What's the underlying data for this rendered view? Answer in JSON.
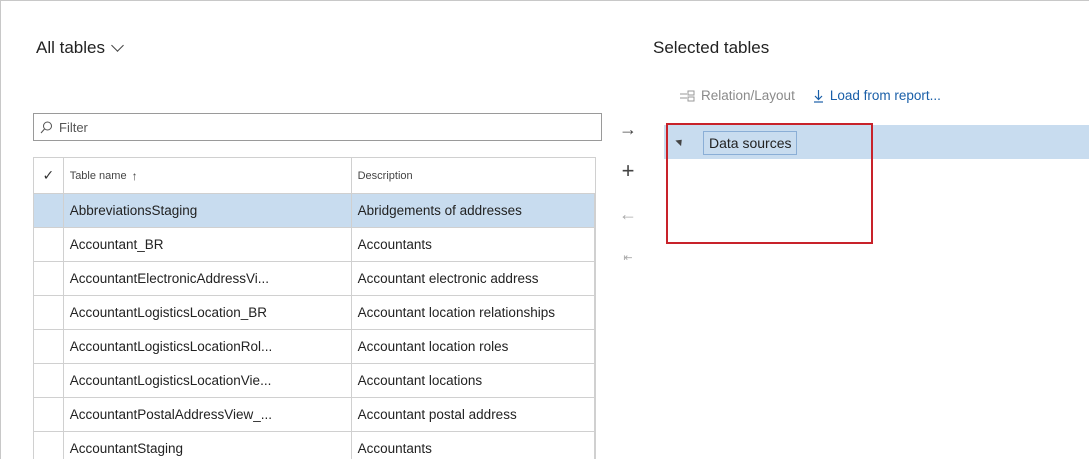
{
  "left_panel": {
    "title": "All tables",
    "filter_placeholder": "Filter",
    "columns": {
      "check": "✓",
      "name": "Table name",
      "sort_indicator": "↑",
      "description": "Description"
    },
    "rows": [
      {
        "name": "AbbreviationsStaging",
        "description": "Abridgements of addresses",
        "selected": true
      },
      {
        "name": "Accountant_BR",
        "description": "Accountants",
        "selected": false
      },
      {
        "name": "AccountantElectronicAddressVi...",
        "description": "Accountant electronic address",
        "selected": false
      },
      {
        "name": "AccountantLogisticsLocation_BR",
        "description": "Accountant location relationships",
        "selected": false
      },
      {
        "name": "AccountantLogisticsLocationRol...",
        "description": "Accountant location roles",
        "selected": false
      },
      {
        "name": "AccountantLogisticsLocationVie...",
        "description": "Accountant locations",
        "selected": false
      },
      {
        "name": "AccountantPostalAddressView_...",
        "description": "Accountant postal address",
        "selected": false
      },
      {
        "name": "AccountantStaging",
        "description": "Accountants",
        "selected": false
      }
    ]
  },
  "side_buttons": {
    "add_selected": "→",
    "add": "+",
    "remove": "←",
    "remove_all": "⇤"
  },
  "right_panel": {
    "title": "Selected tables",
    "toolbar": {
      "relation_layout": "Relation/Layout",
      "load_from_report": "Load from report..."
    },
    "tree": {
      "root_label": "Data sources"
    }
  },
  "colors": {
    "selection": "#c8dcef",
    "link": "#1a5fa8",
    "highlight": "#c8222a"
  }
}
